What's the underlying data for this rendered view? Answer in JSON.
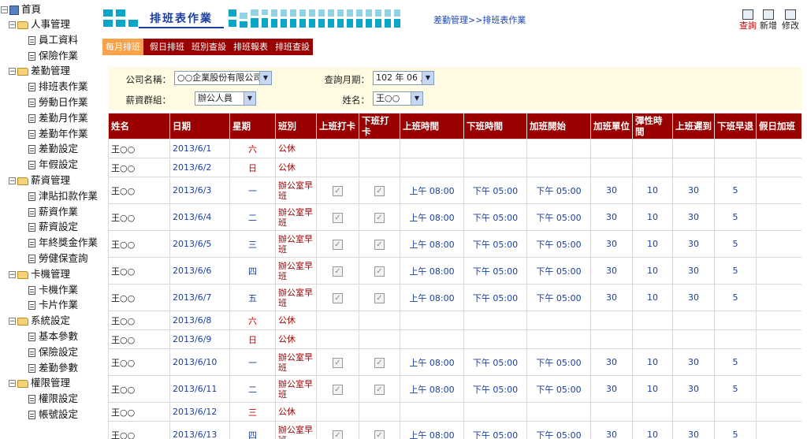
{
  "sidebar": {
    "root": "首頁",
    "groups": [
      {
        "label": "人事管理",
        "items": [
          "員工資料",
          "保險作業"
        ]
      },
      {
        "label": "差勤管理",
        "items": [
          "排班表作業",
          "勞動日作業",
          "差勤月作業",
          "差勤年作業",
          "差勤設定",
          "年假設定"
        ]
      },
      {
        "label": "薪資管理",
        "items": [
          "津貼扣款作業",
          "薪資作業",
          "薪資設定",
          "年終獎金作業",
          "勞健保查詢"
        ]
      },
      {
        "label": "卡機管理",
        "items": [
          "卡機作業",
          "卡片作業"
        ]
      },
      {
        "label": "系統設定",
        "items": [
          "基本參數",
          "保險設定",
          "差勤參數"
        ]
      },
      {
        "label": "權限管理",
        "items": [
          "權限設定",
          "帳號設定"
        ]
      }
    ]
  },
  "header": {
    "title": "排班表作業",
    "breadcrumb": "差勤管理>>排班表作業",
    "toolbar": {
      "query_label": "查詢",
      "add_label": "新增",
      "edit_label": "修改"
    },
    "accent_color": "#0aa6c8"
  },
  "tabs": [
    {
      "label": "每月排班",
      "active": true
    },
    {
      "label": "假日排班",
      "active": false
    },
    {
      "label": "班別查設",
      "active": false
    },
    {
      "label": "排班報表",
      "active": false
    },
    {
      "label": "排班查設",
      "active": false
    }
  ],
  "filter": {
    "company_label": "公司名稱：",
    "company_value": "○○企業股份有限公司",
    "query_month_label": "查詢月期：",
    "query_month_value": "102 年 06 月",
    "salary_group_label": "薪資群組：",
    "salary_group_value": "辦公人員",
    "name_label": "姓名：",
    "name_value": "王○○"
  },
  "grid": {
    "header_color": "#990000",
    "columns": [
      "姓名",
      "日期",
      "星期",
      "班別",
      "上班打卡",
      "下班打卡",
      "上班時間",
      "下班時間",
      "加班開始",
      "加班單位",
      "彈性時間",
      "上班遲到",
      "下班早退",
      "假日加班"
    ],
    "rows": [
      {
        "name": "王○○",
        "date": "2013/6/1",
        "weekday": "六",
        "shift": "公休",
        "weekend": true
      },
      {
        "name": "王○○",
        "date": "2013/6/2",
        "weekday": "日",
        "shift": "公休",
        "weekend": true
      },
      {
        "name": "王○○",
        "date": "2013/6/3",
        "weekday": "一",
        "shift": "辦公室早班",
        "weekend": false,
        "in_check": true,
        "out_check": true,
        "start": "上午 08:00",
        "end": "下午 05:00",
        "ot_start": "下午 05:00",
        "ot_unit": "30",
        "flex": "10",
        "late": "30",
        "early": "5"
      },
      {
        "name": "王○○",
        "date": "2013/6/4",
        "weekday": "二",
        "shift": "辦公室早班",
        "weekend": false,
        "in_check": true,
        "out_check": true,
        "start": "上午 08:00",
        "end": "下午 05:00",
        "ot_start": "下午 05:00",
        "ot_unit": "30",
        "flex": "10",
        "late": "30",
        "early": "5"
      },
      {
        "name": "王○○",
        "date": "2013/6/5",
        "weekday": "三",
        "shift": "辦公室早班",
        "weekend": false,
        "in_check": true,
        "out_check": true,
        "start": "上午 08:00",
        "end": "下午 05:00",
        "ot_start": "下午 05:00",
        "ot_unit": "30",
        "flex": "10",
        "late": "30",
        "early": "5"
      },
      {
        "name": "王○○",
        "date": "2013/6/6",
        "weekday": "四",
        "shift": "辦公室早班",
        "weekend": false,
        "in_check": true,
        "out_check": true,
        "start": "上午 08:00",
        "end": "下午 05:00",
        "ot_start": "下午 05:00",
        "ot_unit": "30",
        "flex": "10",
        "late": "30",
        "early": "5"
      },
      {
        "name": "王○○",
        "date": "2013/6/7",
        "weekday": "五",
        "shift": "辦公室早班",
        "weekend": false,
        "in_check": true,
        "out_check": true,
        "start": "上午 08:00",
        "end": "下午 05:00",
        "ot_start": "下午 05:00",
        "ot_unit": "30",
        "flex": "10",
        "late": "30",
        "early": "5"
      },
      {
        "name": "王○○",
        "date": "2013/6/8",
        "weekday": "六",
        "shift": "公休",
        "weekend": true
      },
      {
        "name": "王○○",
        "date": "2013/6/9",
        "weekday": "日",
        "shift": "公休",
        "weekend": true
      },
      {
        "name": "王○○",
        "date": "2013/6/10",
        "weekday": "一",
        "shift": "辦公室早班",
        "weekend": false,
        "in_check": true,
        "out_check": true,
        "start": "上午 08:00",
        "end": "下午 05:00",
        "ot_start": "下午 05:00",
        "ot_unit": "30",
        "flex": "10",
        "late": "30",
        "early": "5"
      },
      {
        "name": "王○○",
        "date": "2013/6/11",
        "weekday": "二",
        "shift": "辦公室早班",
        "weekend": false,
        "in_check": true,
        "out_check": true,
        "start": "上午 08:00",
        "end": "下午 05:00",
        "ot_start": "下午 05:00",
        "ot_unit": "30",
        "flex": "10",
        "late": "30",
        "early": "5"
      },
      {
        "name": "王○○",
        "date": "2013/6/12",
        "weekday": "三",
        "shift": "公休",
        "weekend": true
      },
      {
        "name": "王○○",
        "date": "2013/6/13",
        "weekday": "四",
        "shift": "辦公室早班",
        "weekend": false,
        "in_check": true,
        "out_check": true,
        "start": "上午 08:00",
        "end": "下午 05:00",
        "ot_start": "下午 05:00",
        "ot_unit": "30",
        "flex": "10",
        "late": "30",
        "early": "5"
      }
    ]
  }
}
